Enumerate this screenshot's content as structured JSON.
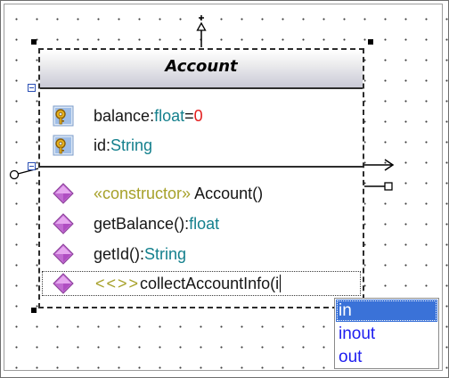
{
  "class": {
    "name": "Account",
    "attributes": [
      {
        "name": "balance",
        "sep": ":",
        "type": "float",
        "eq": "=",
        "default": "0",
        "icon": "attribute-key-icon"
      },
      {
        "name": "id",
        "sep": ":",
        "type": "String",
        "icon": "attribute-key-icon"
      }
    ],
    "operations": [
      {
        "stereotype": "«constructor»",
        "name": " Account()",
        "icon": "operation-diamond-icon"
      },
      {
        "name": "getBalance()",
        "sep": ":",
        "type": "float",
        "icon": "operation-diamond-icon"
      },
      {
        "name": "getId()",
        "sep": ":",
        "type": "String",
        "icon": "operation-diamond-icon"
      }
    ],
    "editing_operation": {
      "stereotype": "<<>>",
      "text": " collectAccountInfo(i",
      "icon": "operation-diamond-icon"
    }
  },
  "autocomplete": {
    "options": [
      "in",
      "inout",
      "out"
    ],
    "selected": "in"
  },
  "colors": {
    "name": "#161616",
    "type": "#14808d",
    "default_value": "#e31d1d",
    "stereotype": "#a7a12a",
    "dropdown_text": "#1d1df0",
    "selection": "#3a72d8"
  }
}
